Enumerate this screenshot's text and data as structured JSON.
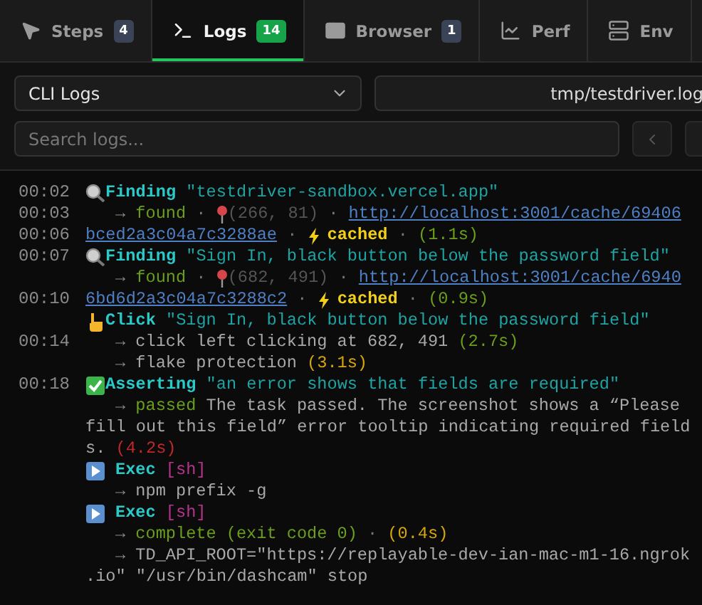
{
  "tabs": [
    {
      "label": "Steps",
      "badge": "4",
      "selected": false
    },
    {
      "label": "Logs",
      "badge": "14",
      "selected": true
    },
    {
      "label": "Browser",
      "badge": "1",
      "selected": false
    },
    {
      "label": "Perf",
      "selected": false
    },
    {
      "label": "Env",
      "selected": false
    }
  ],
  "source_select": {
    "value": "CLI Logs"
  },
  "file_path": {
    "value": "tmp/testdriver.log"
  },
  "search": {
    "placeholder": "Search logs..."
  },
  "log_lines": [
    {
      "time": "00:02",
      "kind": "finding",
      "segments": [
        {
          "kind": "keyword",
          "text": "Finding"
        },
        {
          "kind": "quote",
          "text": " \"testdriver-sandbox.vercel.app\""
        }
      ]
    },
    {
      "time": "00:03",
      "kind": "detail",
      "segments": [
        {
          "kind": "arrow",
          "text": "→"
        },
        {
          "kind": "ok",
          "text": " found"
        },
        {
          "kind": "sep",
          "text": " · "
        },
        {
          "kind": "coords",
          "text": "(266, 81)"
        },
        {
          "kind": "sep",
          "text": " · "
        },
        {
          "kind": "link",
          "text": "http://localhost:3001/cache/69406"
        }
      ]
    },
    {
      "time": "00:06",
      "kind": "wrap",
      "segments": [
        {
          "kind": "link",
          "text": "bced2a3c04a7c3288ae"
        },
        {
          "kind": "sep",
          "text": " · "
        },
        {
          "kind": "cached",
          "text": "cached"
        },
        {
          "kind": "sep",
          "text": " · "
        },
        {
          "kind": "duration_ok",
          "text": "(1.1s)"
        }
      ]
    },
    {
      "time": "00:07",
      "kind": "finding",
      "segments": [
        {
          "kind": "keyword",
          "text": "Finding"
        },
        {
          "kind": "quote",
          "text": " \"Sign In, black button below the password field\""
        }
      ]
    },
    {
      "kind": "detail",
      "segments": [
        {
          "kind": "arrow",
          "text": "→"
        },
        {
          "kind": "ok",
          "text": " found"
        },
        {
          "kind": "sep",
          "text": " · "
        },
        {
          "kind": "coords",
          "text": "(682, 491)"
        },
        {
          "kind": "sep",
          "text": " · "
        },
        {
          "kind": "link",
          "text": "http://localhost:3001/cache/6940"
        }
      ]
    },
    {
      "time": "00:10",
      "kind": "wrap",
      "segments": [
        {
          "kind": "link",
          "text": "6bd6d2a3c04a7c3288c2"
        },
        {
          "kind": "sep",
          "text": " · "
        },
        {
          "kind": "cached",
          "text": "cached"
        },
        {
          "kind": "sep",
          "text": " · "
        },
        {
          "kind": "duration_ok",
          "text": "(0.9s)"
        }
      ]
    },
    {
      "kind": "click",
      "segments": [
        {
          "kind": "keyword",
          "text": "Click"
        },
        {
          "kind": "quote",
          "text": " \"Sign In, black button below the password field\""
        }
      ]
    },
    {
      "time": "00:14",
      "kind": "detail",
      "segments": [
        {
          "kind": "arrow",
          "text": "→"
        },
        {
          "kind": "text",
          "text": " click left clicking at 682, 491 "
        },
        {
          "kind": "duration_ok",
          "text": "(2.7s)"
        }
      ]
    },
    {
      "kind": "detail",
      "segments": [
        {
          "kind": "arrow",
          "text": "→"
        },
        {
          "kind": "text",
          "text": " flake protection "
        },
        {
          "kind": "duration_warn",
          "text": "(3.1s)"
        }
      ]
    },
    {
      "time": "00:18",
      "kind": "assert",
      "segments": [
        {
          "kind": "keyword",
          "text": "Asserting"
        },
        {
          "kind": "quote",
          "text": " \"an error shows that fields are required\""
        }
      ]
    },
    {
      "kind": "detail",
      "segments": [
        {
          "kind": "arrow",
          "text": "→"
        },
        {
          "kind": "ok",
          "text": " passed"
        },
        {
          "kind": "text",
          "text": " The task passed. The screenshot shows a “Please"
        }
      ]
    },
    {
      "kind": "wrap",
      "segments": [
        {
          "kind": "text",
          "text": "fill out this field” error tooltip indicating required field"
        }
      ]
    },
    {
      "kind": "wrap",
      "segments": [
        {
          "kind": "text",
          "text": "s. "
        },
        {
          "kind": "duration_bad",
          "text": "(4.2s)"
        }
      ]
    },
    {
      "kind": "exec",
      "segments": [
        {
          "kind": "keyword",
          "text": "Exec"
        },
        {
          "kind": "tag",
          "text": " [sh]"
        }
      ]
    },
    {
      "kind": "detail",
      "segments": [
        {
          "kind": "arrow",
          "text": "→"
        },
        {
          "kind": "text",
          "text": " npm prefix -g"
        }
      ]
    },
    {
      "kind": "exec",
      "segments": [
        {
          "kind": "keyword",
          "text": "Exec"
        },
        {
          "kind": "tag",
          "text": " [sh]"
        }
      ]
    },
    {
      "kind": "detail",
      "segments": [
        {
          "kind": "arrow",
          "text": "→"
        },
        {
          "kind": "ok",
          "text": " complete (exit code 0)"
        },
        {
          "kind": "sep",
          "text": " · "
        },
        {
          "kind": "duration_warn",
          "text": "(0.4s)"
        }
      ]
    },
    {
      "kind": "detail",
      "segments": [
        {
          "kind": "arrow",
          "text": "→"
        },
        {
          "kind": "text",
          "text": " TD_API_ROOT=\"https://replayable-dev-ian-mac-m1-16.ngrok"
        }
      ]
    },
    {
      "kind": "wrap",
      "segments": [
        {
          "kind": "text",
          "text": ".io\" \"/usr/bin/dashcam\" stop"
        }
      ]
    }
  ]
}
